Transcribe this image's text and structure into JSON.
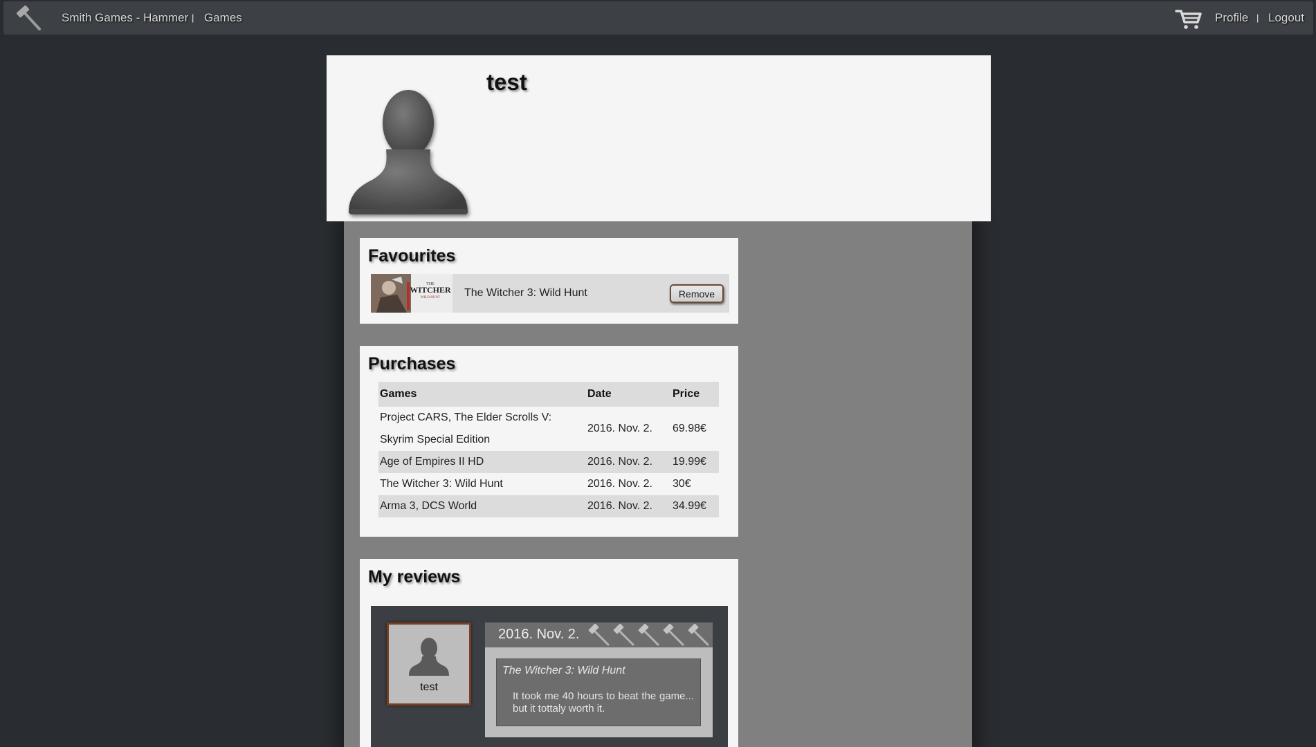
{
  "nav": {
    "brand": "Smith Games - Hammer",
    "separator": "|",
    "games": "Games",
    "profile": "Profile",
    "separator2": "|",
    "logout": "Logout"
  },
  "profile": {
    "username": "test"
  },
  "favourites": {
    "title": "Favourites",
    "items": [
      {
        "name": "The Witcher 3: Wild Hunt",
        "remove_label": "Remove",
        "thumb_text_1": "THE",
        "thumb_text_2": "WITCHER",
        "thumb_text_3": "WILD HUNT"
      }
    ]
  },
  "purchases": {
    "title": "Purchases",
    "columns": [
      "Games",
      "Date",
      "Price"
    ],
    "rows": [
      {
        "games": "Project CARS, The Elder Scrolls V: Skyrim Special Edition",
        "date": "2016. Nov. 2.",
        "price": "69.98€"
      },
      {
        "games": "Age of Empires II HD",
        "date": "2016. Nov. 2.",
        "price": "19.99€"
      },
      {
        "games": "The Witcher 3: Wild Hunt",
        "date": "2016. Nov. 2.",
        "price": "30€"
      },
      {
        "games": "Arma 3, DCS World",
        "date": "2016. Nov. 2.",
        "price": "34.99€"
      }
    ]
  },
  "reviews": {
    "title": "My reviews",
    "items": [
      {
        "author": "test",
        "date": "2016. Nov. 2.",
        "rating": 5,
        "game": "The Witcher 3: Wild Hunt",
        "text": "It took me 40 hours to beat the game... but it tottaly worth it."
      }
    ]
  },
  "colors": {
    "background": "#292c30",
    "navbar": "#3d4146",
    "card": "#f5f5f5",
    "column": "#808080",
    "accent_border": "#7a3f22"
  }
}
